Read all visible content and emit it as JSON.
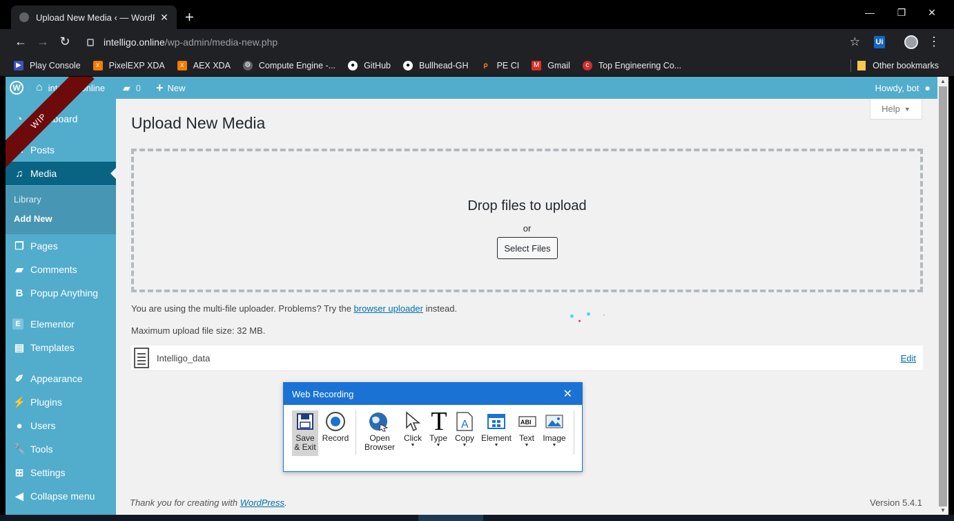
{
  "browser": {
    "tab_title": "Upload New Media ‹ — WordPre",
    "new_tab": "+",
    "url_host": "intelligo.online",
    "url_path": "/wp-admin/media-new.php",
    "bookmarks": [
      {
        "label": "Play Console",
        "icon": "play-console-icon",
        "color": "#3f51b5"
      },
      {
        "label": "PixelEXP XDA",
        "icon": "xda-icon",
        "color": "#f57c00"
      },
      {
        "label": "AEX XDA",
        "icon": "xda-icon",
        "color": "#f57c00"
      },
      {
        "label": "Compute Engine -...",
        "icon": "compute-engine-icon",
        "color": "#5f6368"
      },
      {
        "label": "GitHub",
        "icon": "github-icon",
        "color": "#ffffff"
      },
      {
        "label": "Bullhead-GH",
        "icon": "github-icon",
        "color": "#ffffff"
      },
      {
        "label": "PE CI",
        "icon": "pe-ci-icon",
        "color": "#ff8a00"
      },
      {
        "label": "Gmail",
        "icon": "gmail-icon",
        "color": "#d93025"
      },
      {
        "label": "Top Engineering Co...",
        "icon": "top-engineering-icon",
        "color": "#d32f2f"
      }
    ],
    "other_bookmarks": "Other bookmarks"
  },
  "adminbar": {
    "site_name": "intelligo.online",
    "comments_count": "0",
    "new_label": "New",
    "howdy": "Howdy, bot"
  },
  "ribbon": "WIP",
  "sidebar": {
    "items": [
      {
        "label": "Dashboard",
        "icon": "dashboard-icon"
      },
      {
        "label": "Posts",
        "icon": "posts-icon"
      },
      {
        "label": "Media",
        "icon": "media-icon"
      },
      {
        "label": "Pages",
        "icon": "pages-icon"
      },
      {
        "label": "Comments",
        "icon": "comments-icon"
      },
      {
        "label": "Popup Anything",
        "icon": "popup-anything-icon"
      },
      {
        "label": "Elementor",
        "icon": "elementor-icon"
      },
      {
        "label": "Templates",
        "icon": "templates-icon"
      },
      {
        "label": "Appearance",
        "icon": "appearance-icon"
      },
      {
        "label": "Plugins",
        "icon": "plugins-icon"
      },
      {
        "label": "Users",
        "icon": "users-icon"
      },
      {
        "label": "Tools",
        "icon": "tools-icon"
      },
      {
        "label": "Settings",
        "icon": "settings-icon"
      },
      {
        "label": "Collapse menu",
        "icon": "collapse-icon"
      }
    ],
    "submenu": [
      {
        "label": "Library"
      },
      {
        "label": "Add New"
      }
    ]
  },
  "main": {
    "help": "Help",
    "title": "Upload New Media",
    "drop_title": "Drop files to upload",
    "drop_or": "or",
    "select_files": "Select Files",
    "note_prefix": "You are using the multi-file uploader. Problems? Try the ",
    "note_link": "browser uploader",
    "note_suffix": " instead.",
    "max_size": "Maximum upload file size: 32 MB.",
    "file_name": "Intelligo_data",
    "edit": "Edit",
    "footer_prefix": "Thank you for creating with ",
    "footer_link": "WordPress",
    "footer_suffix": ".",
    "version": "Version 5.4.1"
  },
  "recorder": {
    "title": "Web Recording",
    "tools": [
      {
        "label": "Save & Exit",
        "icon": "save-icon"
      },
      {
        "label": "Record",
        "icon": "record-icon"
      },
      {
        "label": "Open Browser",
        "icon": "open-browser-icon"
      },
      {
        "label": "Click",
        "icon": "click-icon"
      },
      {
        "label": "Type",
        "icon": "type-icon"
      },
      {
        "label": "Copy",
        "icon": "copy-icon"
      },
      {
        "label": "Element",
        "icon": "element-icon"
      },
      {
        "label": "Text",
        "icon": "text-icon"
      },
      {
        "label": "Image",
        "icon": "image-icon"
      }
    ]
  },
  "colors": {
    "wp_accent": "#52accc",
    "wp_current": "#096484",
    "recorder_blue": "#1a73d4",
    "ribbon": "#6d0b0b"
  }
}
